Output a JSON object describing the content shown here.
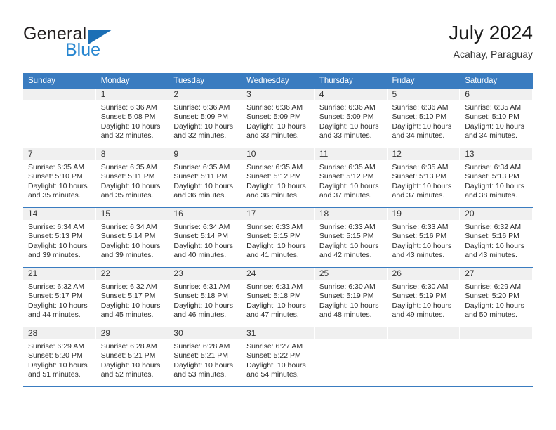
{
  "brand": {
    "name_top": "General",
    "name_bottom": "Blue",
    "triangle_color": "#1c6fb5",
    "blue_text_color": "#2786d0"
  },
  "header": {
    "title": "July 2024",
    "subtitle": "Acahay, Paraguay",
    "accent_color": "#3a7cc0",
    "band_color": "#f0f0f0"
  },
  "calendar": {
    "weekday_headers": [
      "Sunday",
      "Monday",
      "Tuesday",
      "Wednesday",
      "Thursday",
      "Friday",
      "Saturday"
    ],
    "weeks": [
      [
        {
          "day": "",
          "sunrise": "",
          "sunset": "",
          "daylight_line1": "",
          "daylight_line2": ""
        },
        {
          "day": "1",
          "sunrise": "Sunrise: 6:36 AM",
          "sunset": "Sunset: 5:08 PM",
          "daylight_line1": "Daylight: 10 hours",
          "daylight_line2": "and 32 minutes."
        },
        {
          "day": "2",
          "sunrise": "Sunrise: 6:36 AM",
          "sunset": "Sunset: 5:09 PM",
          "daylight_line1": "Daylight: 10 hours",
          "daylight_line2": "and 32 minutes."
        },
        {
          "day": "3",
          "sunrise": "Sunrise: 6:36 AM",
          "sunset": "Sunset: 5:09 PM",
          "daylight_line1": "Daylight: 10 hours",
          "daylight_line2": "and 33 minutes."
        },
        {
          "day": "4",
          "sunrise": "Sunrise: 6:36 AM",
          "sunset": "Sunset: 5:09 PM",
          "daylight_line1": "Daylight: 10 hours",
          "daylight_line2": "and 33 minutes."
        },
        {
          "day": "5",
          "sunrise": "Sunrise: 6:36 AM",
          "sunset": "Sunset: 5:10 PM",
          "daylight_line1": "Daylight: 10 hours",
          "daylight_line2": "and 34 minutes."
        },
        {
          "day": "6",
          "sunrise": "Sunrise: 6:35 AM",
          "sunset": "Sunset: 5:10 PM",
          "daylight_line1": "Daylight: 10 hours",
          "daylight_line2": "and 34 minutes."
        }
      ],
      [
        {
          "day": "7",
          "sunrise": "Sunrise: 6:35 AM",
          "sunset": "Sunset: 5:10 PM",
          "daylight_line1": "Daylight: 10 hours",
          "daylight_line2": "and 35 minutes."
        },
        {
          "day": "8",
          "sunrise": "Sunrise: 6:35 AM",
          "sunset": "Sunset: 5:11 PM",
          "daylight_line1": "Daylight: 10 hours",
          "daylight_line2": "and 35 minutes."
        },
        {
          "day": "9",
          "sunrise": "Sunrise: 6:35 AM",
          "sunset": "Sunset: 5:11 PM",
          "daylight_line1": "Daylight: 10 hours",
          "daylight_line2": "and 36 minutes."
        },
        {
          "day": "10",
          "sunrise": "Sunrise: 6:35 AM",
          "sunset": "Sunset: 5:12 PM",
          "daylight_line1": "Daylight: 10 hours",
          "daylight_line2": "and 36 minutes."
        },
        {
          "day": "11",
          "sunrise": "Sunrise: 6:35 AM",
          "sunset": "Sunset: 5:12 PM",
          "daylight_line1": "Daylight: 10 hours",
          "daylight_line2": "and 37 minutes."
        },
        {
          "day": "12",
          "sunrise": "Sunrise: 6:35 AM",
          "sunset": "Sunset: 5:13 PM",
          "daylight_line1": "Daylight: 10 hours",
          "daylight_line2": "and 37 minutes."
        },
        {
          "day": "13",
          "sunrise": "Sunrise: 6:34 AM",
          "sunset": "Sunset: 5:13 PM",
          "daylight_line1": "Daylight: 10 hours",
          "daylight_line2": "and 38 minutes."
        }
      ],
      [
        {
          "day": "14",
          "sunrise": "Sunrise: 6:34 AM",
          "sunset": "Sunset: 5:13 PM",
          "daylight_line1": "Daylight: 10 hours",
          "daylight_line2": "and 39 minutes."
        },
        {
          "day": "15",
          "sunrise": "Sunrise: 6:34 AM",
          "sunset": "Sunset: 5:14 PM",
          "daylight_line1": "Daylight: 10 hours",
          "daylight_line2": "and 39 minutes."
        },
        {
          "day": "16",
          "sunrise": "Sunrise: 6:34 AM",
          "sunset": "Sunset: 5:14 PM",
          "daylight_line1": "Daylight: 10 hours",
          "daylight_line2": "and 40 minutes."
        },
        {
          "day": "17",
          "sunrise": "Sunrise: 6:33 AM",
          "sunset": "Sunset: 5:15 PM",
          "daylight_line1": "Daylight: 10 hours",
          "daylight_line2": "and 41 minutes."
        },
        {
          "day": "18",
          "sunrise": "Sunrise: 6:33 AM",
          "sunset": "Sunset: 5:15 PM",
          "daylight_line1": "Daylight: 10 hours",
          "daylight_line2": "and 42 minutes."
        },
        {
          "day": "19",
          "sunrise": "Sunrise: 6:33 AM",
          "sunset": "Sunset: 5:16 PM",
          "daylight_line1": "Daylight: 10 hours",
          "daylight_line2": "and 43 minutes."
        },
        {
          "day": "20",
          "sunrise": "Sunrise: 6:32 AM",
          "sunset": "Sunset: 5:16 PM",
          "daylight_line1": "Daylight: 10 hours",
          "daylight_line2": "and 43 minutes."
        }
      ],
      [
        {
          "day": "21",
          "sunrise": "Sunrise: 6:32 AM",
          "sunset": "Sunset: 5:17 PM",
          "daylight_line1": "Daylight: 10 hours",
          "daylight_line2": "and 44 minutes."
        },
        {
          "day": "22",
          "sunrise": "Sunrise: 6:32 AM",
          "sunset": "Sunset: 5:17 PM",
          "daylight_line1": "Daylight: 10 hours",
          "daylight_line2": "and 45 minutes."
        },
        {
          "day": "23",
          "sunrise": "Sunrise: 6:31 AM",
          "sunset": "Sunset: 5:18 PM",
          "daylight_line1": "Daylight: 10 hours",
          "daylight_line2": "and 46 minutes."
        },
        {
          "day": "24",
          "sunrise": "Sunrise: 6:31 AM",
          "sunset": "Sunset: 5:18 PM",
          "daylight_line1": "Daylight: 10 hours",
          "daylight_line2": "and 47 minutes."
        },
        {
          "day": "25",
          "sunrise": "Sunrise: 6:30 AM",
          "sunset": "Sunset: 5:19 PM",
          "daylight_line1": "Daylight: 10 hours",
          "daylight_line2": "and 48 minutes."
        },
        {
          "day": "26",
          "sunrise": "Sunrise: 6:30 AM",
          "sunset": "Sunset: 5:19 PM",
          "daylight_line1": "Daylight: 10 hours",
          "daylight_line2": "and 49 minutes."
        },
        {
          "day": "27",
          "sunrise": "Sunrise: 6:29 AM",
          "sunset": "Sunset: 5:20 PM",
          "daylight_line1": "Daylight: 10 hours",
          "daylight_line2": "and 50 minutes."
        }
      ],
      [
        {
          "day": "28",
          "sunrise": "Sunrise: 6:29 AM",
          "sunset": "Sunset: 5:20 PM",
          "daylight_line1": "Daylight: 10 hours",
          "daylight_line2": "and 51 minutes."
        },
        {
          "day": "29",
          "sunrise": "Sunrise: 6:28 AM",
          "sunset": "Sunset: 5:21 PM",
          "daylight_line1": "Daylight: 10 hours",
          "daylight_line2": "and 52 minutes."
        },
        {
          "day": "30",
          "sunrise": "Sunrise: 6:28 AM",
          "sunset": "Sunset: 5:21 PM",
          "daylight_line1": "Daylight: 10 hours",
          "daylight_line2": "and 53 minutes."
        },
        {
          "day": "31",
          "sunrise": "Sunrise: 6:27 AM",
          "sunset": "Sunset: 5:22 PM",
          "daylight_line1": "Daylight: 10 hours",
          "daylight_line2": "and 54 minutes."
        },
        {
          "day": "",
          "sunrise": "",
          "sunset": "",
          "daylight_line1": "",
          "daylight_line2": ""
        },
        {
          "day": "",
          "sunrise": "",
          "sunset": "",
          "daylight_line1": "",
          "daylight_line2": ""
        },
        {
          "day": "",
          "sunrise": "",
          "sunset": "",
          "daylight_line1": "",
          "daylight_line2": ""
        }
      ]
    ]
  }
}
